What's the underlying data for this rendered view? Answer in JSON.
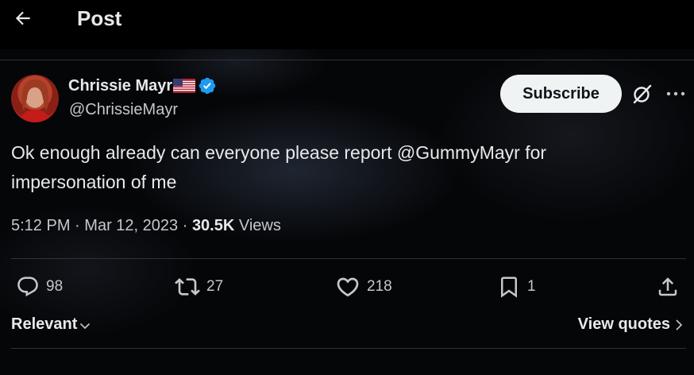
{
  "header": {
    "title": "Post",
    "back_icon": "arrow-left-icon"
  },
  "post": {
    "author": {
      "display_name": "Chrissie Mayr",
      "flag": "🇺🇸",
      "verified": true,
      "handle": "@ChrissieMayr"
    },
    "subscribe_label": "Subscribe",
    "text": "Ok enough already can everyone please report @GummyMayr for impersonation of me",
    "time": "5:12 PM",
    "date": "Mar 12, 2023",
    "views_count": "30.5K",
    "views_label": "Views",
    "dot": "·"
  },
  "actions": {
    "replies": "98",
    "reposts": "27",
    "likes": "218",
    "bookmarks": "1"
  },
  "replies_sort": {
    "label": "Relevant"
  },
  "view_quotes_label": "View quotes",
  "colors": {
    "text_primary": "#e7e9ea",
    "text_secondary": "#c4c8cc",
    "divider": "#2f3336",
    "verified_blue": "#1d9bf0",
    "button_bg": "#eff3f4"
  }
}
